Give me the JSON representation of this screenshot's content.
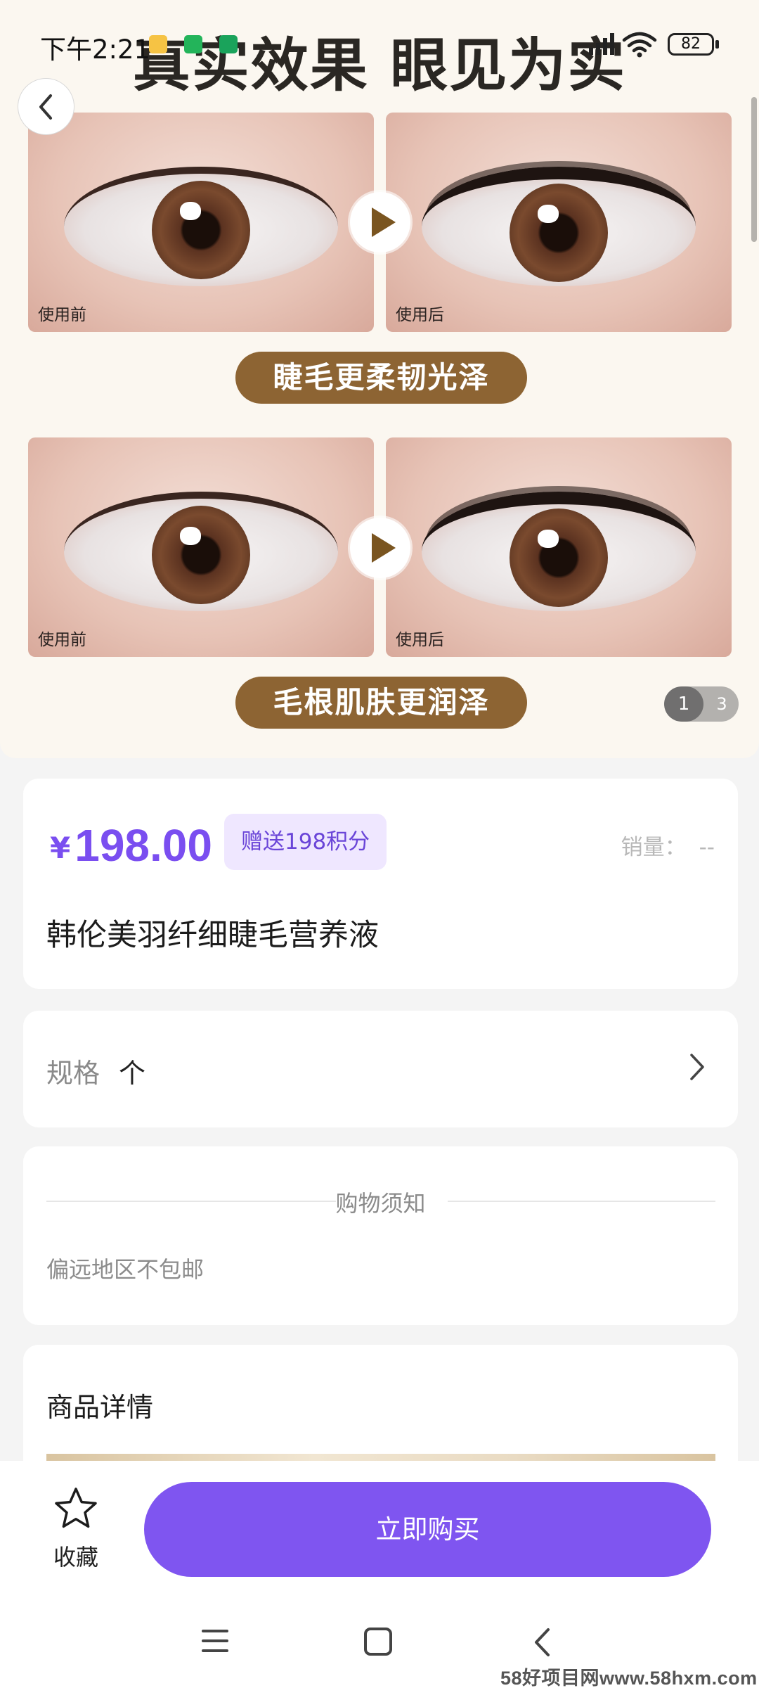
{
  "status_bar": {
    "time": "下午2:21",
    "battery": "82"
  },
  "hero": {
    "title": "真实效果 眼见为实",
    "before_label": "使用前",
    "after_label": "使用后",
    "pill_1": "睫毛更柔韧光泽",
    "pill_2": "毛根肌肤更润泽",
    "pager_current": "1",
    "pager_total": "3"
  },
  "product": {
    "currency": "¥",
    "price": "198.00",
    "points_badge": "赠送198积分",
    "sales_label": "销量：",
    "sales_value": "--",
    "name": "韩伦美羽纤细睫毛营养液"
  },
  "spec": {
    "label": "规格",
    "value": "个"
  },
  "notice": {
    "title": "购物须知",
    "text": "偏远地区不包邮"
  },
  "detail": {
    "title": "商品详情"
  },
  "bottom": {
    "favorite_label": "收藏",
    "buy_label": "立即购买"
  },
  "watermark": "58好项目网www.58hxm.com",
  "colors": {
    "accent": "#7f55f0",
    "price": "#7a4ef0",
    "badge_bg": "#efe7ff",
    "hero_pill": "#8d6433",
    "page_bg": "#f4f4f4"
  },
  "icons": {
    "back": "chevron-left-icon",
    "spec_arrow": "chevron-right-icon",
    "favorite": "star-icon",
    "nav_menu": "menu-icon",
    "nav_home": "home-square-icon",
    "nav_back": "back-icon"
  }
}
